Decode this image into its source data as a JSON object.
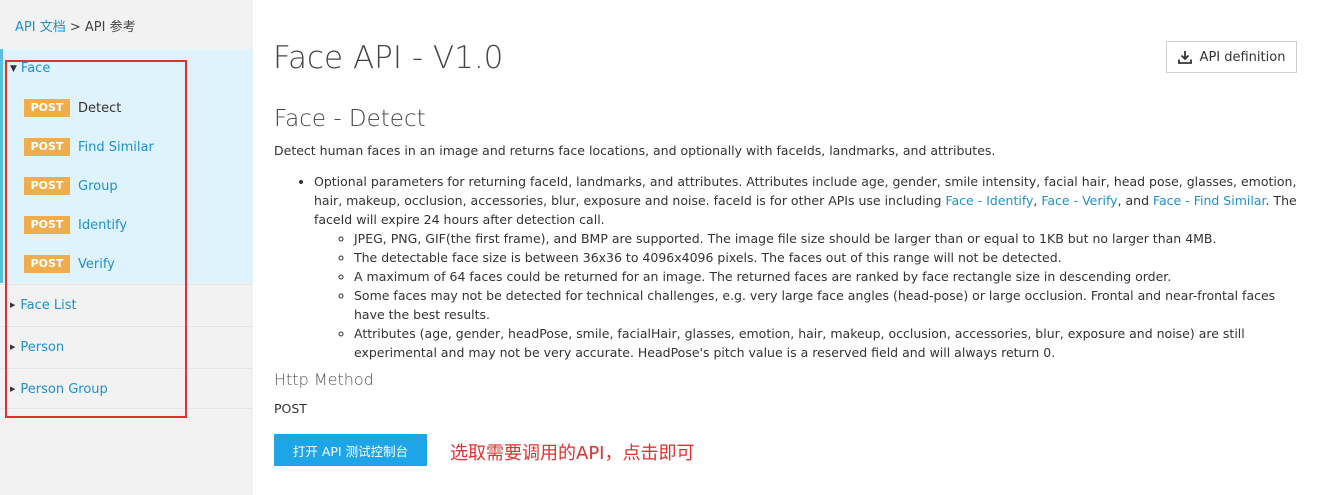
{
  "breadcrumb": {
    "link": "API 文档",
    "separator": " > ",
    "current": "API 参考"
  },
  "sidebar": {
    "face_group": {
      "label": "Face",
      "operations": [
        {
          "method": "POST",
          "label": "Detect",
          "active": true
        },
        {
          "method": "POST",
          "label": "Find Similar"
        },
        {
          "method": "POST",
          "label": "Group"
        },
        {
          "method": "POST",
          "label": "Identify"
        },
        {
          "method": "POST",
          "label": "Verify"
        }
      ]
    },
    "groups": [
      "Face List",
      "Person",
      "Person Group"
    ]
  },
  "main": {
    "title": "Face API - V1.0",
    "definition_button": "API definition",
    "operation_title": "Face - Detect",
    "description": "Detect human faces in an image and returns face locations, and optionally with faceIds, landmarks, and attributes.",
    "bullet_intro": "Optional parameters for returning faceId, landmarks, and attributes. Attributes include age, gender, smile intensity, facial hair, head pose, glasses, emotion, hair, makeup, occlusion, accessories, blur, exposure and noise. faceId is for other APIs use including ",
    "links": [
      "Face - Identify",
      "Face - Verify",
      "Face - Find Similar"
    ],
    "link_sep_1": ", ",
    "link_sep_2": ", and ",
    "bullet_outro": ". The faceId will expire 24 hours after detection call.",
    "sub_bullets": [
      "JPEG, PNG, GIF(the first frame), and BMP are supported. The image file size should be larger than or equal to 1KB but no larger than 4MB.",
      "The detectable face size is between 36x36 to 4096x4096 pixels. The faces out of this range will not be detected.",
      "A maximum of 64 faces could be returned for an image. The returned faces are ranked by face rectangle size in descending order.",
      "Some faces may not be detected for technical challenges, e.g. very large face angles (head-pose) or large occlusion. Frontal and near-frontal faces have the best results.",
      "Attributes (age, gender, headPose, smile, facialHair, glasses, emotion, hair, makeup, occlusion, accessories, blur, exposure and noise) are still experimental and may not be very accurate. HeadPose's pitch value is a reserved field and will always return 0."
    ],
    "http_method_label": "Http Method",
    "http_method_value": "POST",
    "console_button": "打开 API 测试控制台",
    "annotation": "选取需要调用的API，点击即可"
  },
  "colors": {
    "link": "#1e90d0",
    "badge": "#f0ad4e",
    "primary_button": "#1ea5e8",
    "annotation": "#e03030",
    "face_group_bg": "#dff3fc"
  },
  "icons": {
    "definition_button": "download-icon",
    "expanded_caret": "caret-down-icon",
    "collapsed_caret": "caret-right-icon"
  }
}
